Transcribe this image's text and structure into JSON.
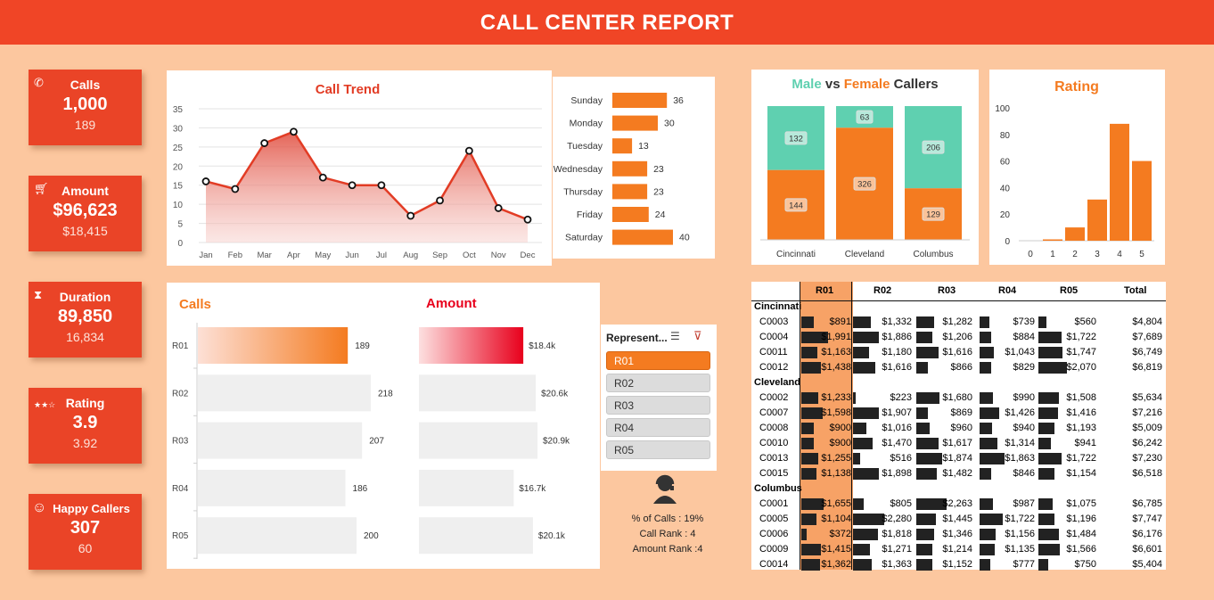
{
  "header": {
    "title": "CALL CENTER REPORT"
  },
  "kpis": [
    {
      "title": "Calls",
      "value": "1,000",
      "sub": "189",
      "icon": "phone-icon"
    },
    {
      "title": "Amount",
      "value": "$96,623",
      "sub": "$18,415",
      "icon": "cart-icon"
    },
    {
      "title": "Duration",
      "value": "89,850",
      "sub": "16,834",
      "icon": "hourglass-icon"
    },
    {
      "title": "Rating",
      "value": "3.9",
      "sub": "3.92",
      "icon": "stars-icon"
    },
    {
      "title": "Happy Callers",
      "value": "307",
      "sub": "60",
      "icon": "smile-icon"
    }
  ],
  "colors": {
    "accent": "#f04526",
    "orange": "#f47b20",
    "teal": "#5fd0b0",
    "background": "#fcc79f"
  },
  "chart_data": [
    {
      "type": "area",
      "title": "Call Trend",
      "categories": [
        "Jan",
        "Feb",
        "Mar",
        "Apr",
        "May",
        "Jun",
        "Jul",
        "Aug",
        "Sep",
        "Oct",
        "Nov",
        "Dec"
      ],
      "values": [
        16,
        14,
        26,
        29,
        17,
        15,
        15,
        7,
        11,
        24,
        9,
        6
      ],
      "ylim": [
        0,
        35
      ],
      "yticks": [
        "0",
        "5",
        "10",
        "15",
        "20",
        "25",
        "30",
        "35"
      ],
      "grid": true
    },
    {
      "type": "bar",
      "orientation": "horizontal",
      "categories": [
        "Sunday",
        "Monday",
        "Tuesday",
        "Wednesday",
        "Thursday",
        "Friday",
        "Saturday"
      ],
      "values": [
        36,
        30,
        13,
        23,
        23,
        24,
        40
      ],
      "labels": [
        "36",
        "30",
        "13",
        "23",
        "23",
        "24",
        "40"
      ]
    },
    {
      "type": "bar",
      "stacked": true,
      "title": "Male vs Female Callers",
      "title_parts": {
        "male": "Male",
        "vs": "vs",
        "female": "Female",
        "rest": "Callers"
      },
      "categories": [
        "Cincinnati",
        "Cleveland",
        "Columbus"
      ],
      "series": [
        {
          "values": [
            144,
            326,
            129
          ],
          "labels": [
            "144",
            "326",
            "129"
          ]
        },
        {
          "values": [
            132,
            63,
            206
          ],
          "labels": [
            "132",
            "63",
            "206"
          ]
        }
      ]
    },
    {
      "type": "bar",
      "title": "Rating",
      "categories": [
        "0",
        "1",
        "2",
        "3",
        "4",
        "5"
      ],
      "values": [
        0,
        1,
        10,
        31,
        88,
        60
      ],
      "ylim": [
        0,
        100
      ],
      "yticks": [
        "0",
        "20",
        "40",
        "60",
        "80",
        "100"
      ]
    },
    {
      "type": "bar",
      "orientation": "horizontal",
      "title": "Calls",
      "categories": [
        "R01",
        "R02",
        "R03",
        "R04",
        "R05"
      ],
      "values": [
        189,
        218,
        207,
        186,
        200
      ],
      "labels": [
        "189",
        "218",
        "207",
        "186",
        "200"
      ],
      "highlight": "R01"
    },
    {
      "type": "bar",
      "orientation": "horizontal",
      "title": "Amount",
      "categories": [
        "R01",
        "R02",
        "R03",
        "R04",
        "R05"
      ],
      "values": [
        18.4,
        20.6,
        20.9,
        16.7,
        20.1
      ],
      "labels": [
        "$18.4k",
        "$20.6k",
        "$20.9k",
        "$16.7k",
        "$20.1k"
      ],
      "highlight": "R01"
    }
  ],
  "slicer": {
    "title": "Represent...",
    "items": [
      "R01",
      "R02",
      "R03",
      "R04",
      "R05"
    ],
    "selected": "R01"
  },
  "rep_info": {
    "pct_calls": "% of Calls : 19%",
    "call_rank": "Call Rank : 4",
    "amount_rank": "Amount Rank :4"
  },
  "table": {
    "columns": [
      "R01",
      "R02",
      "R03",
      "R04",
      "R05",
      "Total"
    ],
    "groups": [
      {
        "city": "Cincinnati",
        "rows": [
          {
            "id": "C0003",
            "values": [
              "$891",
              "$1,332",
              "$1,282",
              "$739",
              "$560",
              "$4,804"
            ]
          },
          {
            "id": "C0004",
            "values": [
              "$1,991",
              "$1,886",
              "$1,206",
              "$884",
              "$1,722",
              "$7,689"
            ]
          },
          {
            "id": "C0011",
            "values": [
              "$1,163",
              "$1,180",
              "$1,616",
              "$1,043",
              "$1,747",
              "$6,749"
            ]
          },
          {
            "id": "C0012",
            "values": [
              "$1,438",
              "$1,616",
              "$866",
              "$829",
              "$2,070",
              "$6,819"
            ]
          }
        ]
      },
      {
        "city": "Cleveland",
        "rows": [
          {
            "id": "C0002",
            "values": [
              "$1,233",
              "$223",
              "$1,680",
              "$990",
              "$1,508",
              "$5,634"
            ]
          },
          {
            "id": "C0007",
            "values": [
              "$1,598",
              "$1,907",
              "$869",
              "$1,426",
              "$1,416",
              "$7,216"
            ]
          },
          {
            "id": "C0008",
            "values": [
              "$900",
              "$1,016",
              "$960",
              "$940",
              "$1,193",
              "$5,009"
            ]
          },
          {
            "id": "C0010",
            "values": [
              "$900",
              "$1,470",
              "$1,617",
              "$1,314",
              "$941",
              "$6,242"
            ]
          },
          {
            "id": "C0013",
            "values": [
              "$1,255",
              "$516",
              "$1,874",
              "$1,863",
              "$1,722",
              "$7,230"
            ]
          },
          {
            "id": "C0015",
            "values": [
              "$1,138",
              "$1,898",
              "$1,482",
              "$846",
              "$1,154",
              "$6,518"
            ]
          }
        ]
      },
      {
        "city": "Columbus",
        "rows": [
          {
            "id": "C0001",
            "values": [
              "$1,655",
              "$805",
              "$2,263",
              "$987",
              "$1,075",
              "$6,785"
            ]
          },
          {
            "id": "C0005",
            "values": [
              "$1,104",
              "$2,280",
              "$1,445",
              "$1,722",
              "$1,196",
              "$7,747"
            ]
          },
          {
            "id": "C0006",
            "values": [
              "$372",
              "$1,818",
              "$1,346",
              "$1,156",
              "$1,484",
              "$6,176"
            ]
          },
          {
            "id": "C0009",
            "values": [
              "$1,415",
              "$1,271",
              "$1,214",
              "$1,135",
              "$1,566",
              "$6,601"
            ]
          },
          {
            "id": "C0014",
            "values": [
              "$1,362",
              "$1,363",
              "$1,152",
              "$777",
              "$750",
              "$5,404"
            ]
          }
        ]
      }
    ]
  }
}
